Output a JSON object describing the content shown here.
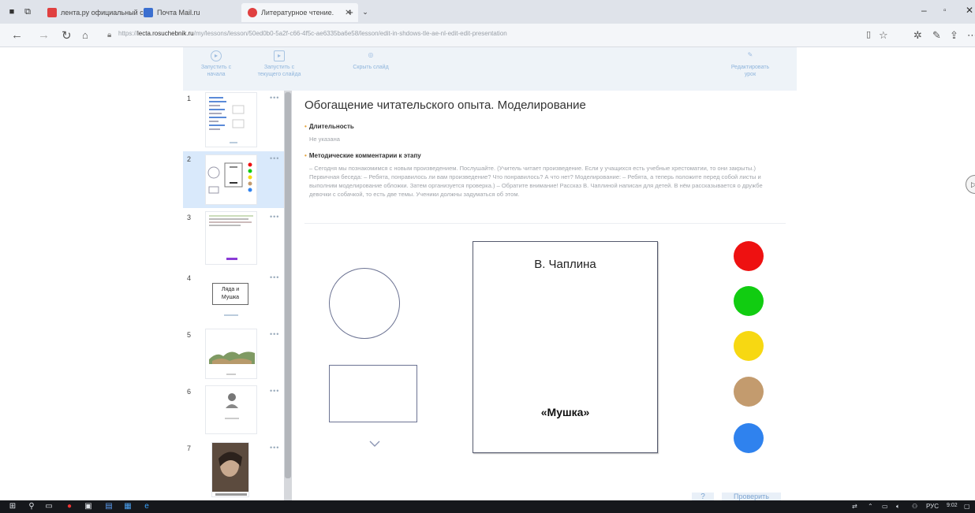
{
  "browser": {
    "tabs": [
      {
        "label": "лента.ру официальный сай",
        "icon": "yandex-icon"
      },
      {
        "label": "Почта Mail.ru",
        "icon": "mail-icon"
      },
      {
        "label": "Литературное чтение.",
        "icon": "lesson-icon",
        "active": true
      }
    ],
    "url_prefix": "https://",
    "url_domain": "lecta.rosuchebnik.ru",
    "url_rest": "/my/lessons/lesson/50ed0b0-5a2f-c66-4f5c-ae6335ba6e58/lesson/edit-in-shdows-tle-ae-nl-edit-edit-presentation",
    "colors": {
      "accent": "#4a90d9",
      "tab_fav": "#e04040"
    }
  },
  "toolbar": {
    "start_label": "Запустить с начала",
    "start_current_label": "Запустить с текущего слайда",
    "hide_slide_label": "Скрыть слайд",
    "edit_label": "Редактировать урок"
  },
  "sidebar": {
    "slides": [
      {
        "num": "1",
        "dots": "•••"
      },
      {
        "num": "2",
        "dots": "•••"
      },
      {
        "num": "3",
        "dots": "•••"
      },
      {
        "num": "4",
        "dots": "•••",
        "text": "Ляда и Мушка"
      },
      {
        "num": "5",
        "dots": "•••"
      },
      {
        "num": "6",
        "dots": "•••"
      },
      {
        "num": "7",
        "dots": "•••"
      }
    ]
  },
  "main": {
    "title": "Обогащение читательского опыта. Моделирование",
    "duration_heading": "Длительность",
    "duration_value": "Не указана",
    "comments_heading": "Методические комментарии к этапу",
    "comments_text": "– Сегодня мы познакомимся с новым произведением. Послушайте. (Учитель читает произведение. Если у учащихся есть учебные хрестоматии, то они закрыты.) Первичная беседа: – Ребята, понравилось ли вам произведение? Что понравилось? А что нет? Моделирование: – Ребята, а теперь положите перед собой листы и выполним моделирование обложки. Затем организуется проверка.) – Обратите внимание! Рассказ В. Чаплиной написан для детей. В нём рассказывается о дружбе девочки с собачкой, то есть две темы. Ученики должны задуматься об этом.",
    "book_author": "В. Чаплина",
    "book_title": "«Мушка»",
    "dot_colors": [
      "#ee1111",
      "#11cc11",
      "#f7d812",
      "#c39b6e",
      "#2f82ee"
    ],
    "help_label": "?",
    "next_label": "Проверить"
  },
  "taskbar": {
    "lang": "РУС",
    "time": "9:02"
  }
}
